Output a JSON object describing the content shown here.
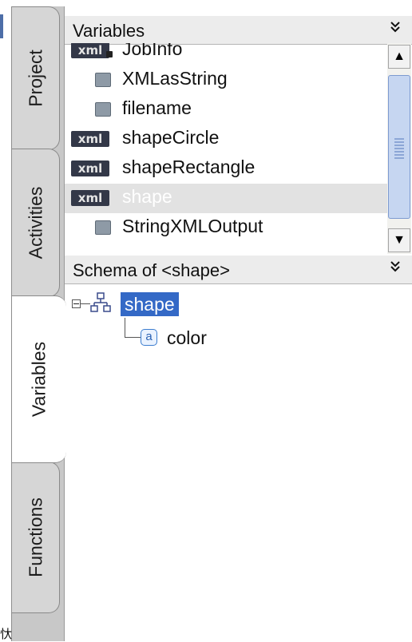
{
  "tabs": [
    {
      "label": "Project"
    },
    {
      "label": "Activities"
    },
    {
      "label": "Variables"
    },
    {
      "label": "Functions"
    }
  ],
  "variables_panel": {
    "title": "Variables",
    "collapse_glyph": "»",
    "items": [
      {
        "label": "JobInfo",
        "icon": "xml-lock-icon"
      },
      {
        "label": "XMLasString",
        "icon": "field-icon"
      },
      {
        "label": "filename",
        "icon": "field-icon"
      },
      {
        "label": "shapeCircle",
        "icon": "xml-icon"
      },
      {
        "label": "shapeRectangle",
        "icon": "xml-icon"
      },
      {
        "label": "shape",
        "icon": "xml-icon",
        "selected": true
      },
      {
        "label": "StringXMLOutput",
        "icon": "field-icon"
      }
    ],
    "xml_badge": "xml",
    "scroll_up": "▲",
    "scroll_down": "▼"
  },
  "schema_panel": {
    "title": "Schema of <shape>",
    "collapse_glyph": "»",
    "root": {
      "label": "shape",
      "icon": "element-tree-icon"
    },
    "children": [
      {
        "label": "color",
        "icon": "attribute-icon",
        "badge": "a"
      }
    ]
  },
  "corner_glyph": "忕",
  "colors": {
    "selection": "#3469c6",
    "selected_row": "#e2e2e2",
    "xml_badge_bg": "#333848",
    "scroll_thumb": "#c6d6f1"
  }
}
